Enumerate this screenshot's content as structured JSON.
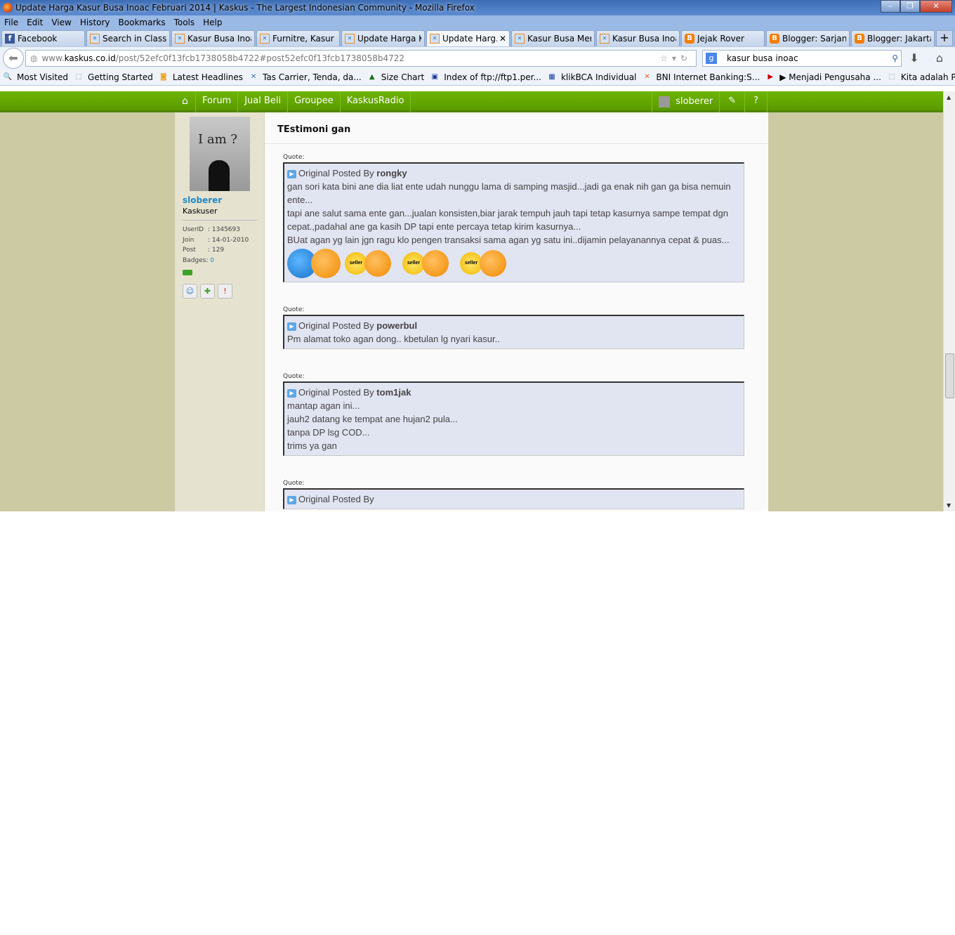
{
  "window": {
    "title": "Update Harga Kasur Busa Inoac Februari 2014 | Kaskus - The Largest Indonesian Community - Mozilla Firefox",
    "buttons": [
      "minimize",
      "maximize",
      "close"
    ]
  },
  "menu": [
    "File",
    "Edit",
    "View",
    "History",
    "Bookmarks",
    "Tools",
    "Help"
  ],
  "tabs": [
    {
      "label": "Facebook",
      "icon": "facebook-icon"
    },
    {
      "label": "Search in Classif...",
      "icon": "kaskus-icon"
    },
    {
      "label": "Kasur Busa Inoa...",
      "icon": "kaskus-icon"
    },
    {
      "label": "Furnitre, Kasur ...",
      "icon": "kaskus-icon"
    },
    {
      "label": "Update Harga K...",
      "icon": "kaskus-icon"
    },
    {
      "label": "Update Harg...",
      "icon": "kaskus-icon",
      "active": true
    },
    {
      "label": "Kasur Busa Mer...",
      "icon": "kaskus-icon"
    },
    {
      "label": "Kasur Busa Inoa...",
      "icon": "kaskus-icon"
    },
    {
      "label": "Jejak Rover",
      "icon": "blogger-icon"
    },
    {
      "label": "Blogger: Sarjana...",
      "icon": "blogger-icon"
    },
    {
      "label": "Blogger: Jakarta...",
      "icon": "blogger-icon"
    }
  ],
  "url": {
    "prefix": "www.",
    "domain": "kaskus.co.id",
    "path": "/post/52efc0f13fcb1738058b4722#post52efc0f13fcb1738058b4722"
  },
  "search": {
    "value": "kasur busa inoac"
  },
  "bookmarks": [
    "Most Visited",
    "Getting Started",
    "Latest Headlines",
    "Tas Carrier, Tenda, da...",
    "Size Chart",
    "Index of ftp://ftp1.per...",
    "klikBCA Individual",
    "BNI Internet Banking:S...",
    "▶ Menjadi Pengusaha ...",
    "Kita adalah Penyambu..."
  ],
  "site_nav": {
    "items": [
      "Forum",
      "Jual Beli",
      "Groupee",
      "KaskusRadio"
    ],
    "user": "sloberer"
  },
  "profile": {
    "username": "sloberer",
    "rank": "Kaskuser",
    "userid_label": "UserID",
    "userid": ": 1345693",
    "join_label": "Join",
    "join": ": 14-01-2010",
    "post_label": "Post",
    "post": ": 129",
    "badges_label": "Badges:",
    "badges": "0",
    "avatar_text": "I am ?"
  },
  "post": {
    "title": "TEstimoni gan",
    "quote_label": "Quote:",
    "posted_by": "Original Posted By",
    "quotes": [
      {
        "author": "rongky",
        "lines": [
          "gan sori kata bini ane dia liat ente udah nunggu lama di samping masjid...jadi ga enak nih gan ga bisa nemuin ente...",
          "tapi ane salut sama ente gan...jualan konsisten,biar jarak tempuh jauh tapi tetap kasurnya sampe tempat dgn cepat.,padahal ane ga kasih DP tapi ente percaya tetap kirim kasurnya...",
          "BUat agan yg lain jgn ragu klo pengen transaksi sama agan yg satu ini..dijamin pelayanannya cepat & puas..."
        ],
        "seller_label": "seller"
      },
      {
        "author": "powerbul",
        "lines": [
          "Pm alamat toko agan dong.. kbetulan lg nyari kasur.."
        ]
      },
      {
        "author": "tom1jak",
        "lines": [
          "mantap agan ini...",
          "jauh2 datang ke tempat ane hujan2 pula...",
          "tanpa DP lsg COD...",
          "trims ya gan"
        ]
      }
    ]
  }
}
